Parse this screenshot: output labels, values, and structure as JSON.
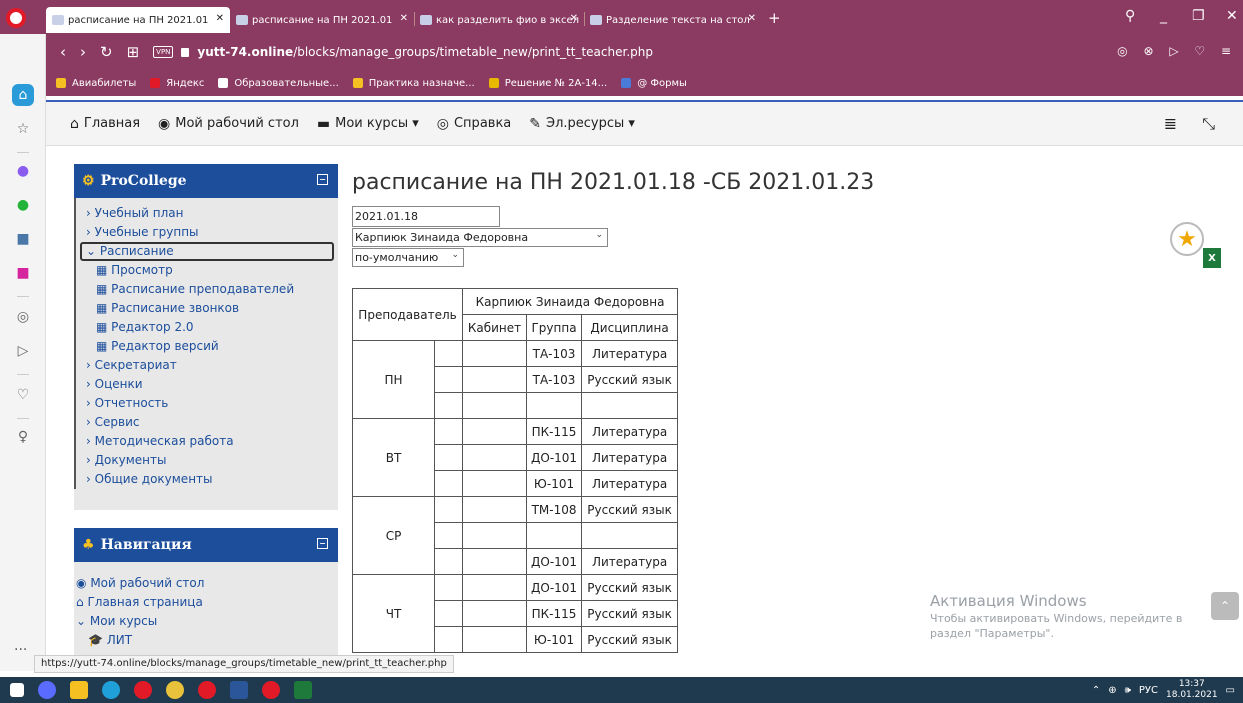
{
  "browser": {
    "tabs": [
      {
        "label": "расписание на ПН 2021.01",
        "active": true
      },
      {
        "label": "расписание на ПН 2021.01",
        "active": false
      },
      {
        "label": "как разделить фио в эксел",
        "active": false
      },
      {
        "label": "Разделение текста на стол",
        "active": false
      }
    ],
    "url_domain": "yutt-74.online",
    "url_path": "/blocks/manage_groups/timetable_new/print_tt_teacher.php",
    "vpn_label": "VPN",
    "bookmarks": [
      "Авиабилеты",
      "Яндекс",
      "Образовательные...",
      "Практика назначе...",
      "Решение № 2А-14...",
      "@ Формы"
    ],
    "status_url": "https://yutt-74.online/blocks/manage_groups/timetable_new/print_tt_teacher.php"
  },
  "navbar": {
    "items": [
      "Главная",
      "Мой рабочий стол",
      "Мои курсы ▾",
      "Справка",
      "Эл.ресурсы ▾"
    ]
  },
  "procollege": {
    "title": "ProCollege",
    "items": [
      {
        "label": "Учебный план",
        "level": 0,
        "prefix": "›"
      },
      {
        "label": "Учебные группы",
        "level": 0,
        "prefix": "›"
      },
      {
        "label": "Расписание",
        "level": 0,
        "prefix": "⌄",
        "selected": true
      },
      {
        "label": "Просмотр",
        "level": 1
      },
      {
        "label": "Расписание преподавателей",
        "level": 1
      },
      {
        "label": "Расписание звонков",
        "level": 1
      },
      {
        "label": "Редактор 2.0",
        "level": 1
      },
      {
        "label": "Редактор версий",
        "level": 1
      },
      {
        "label": "Секретариат",
        "level": 0,
        "prefix": "›"
      },
      {
        "label": "Оценки",
        "level": 0,
        "prefix": "›"
      },
      {
        "label": "Отчетность",
        "level": 0,
        "prefix": "›"
      },
      {
        "label": "Сервис",
        "level": 0,
        "prefix": "›"
      },
      {
        "label": "Методическая работа",
        "level": 0,
        "prefix": "›"
      },
      {
        "label": "Документы",
        "level": 0,
        "prefix": "›"
      },
      {
        "label": "Общие документы",
        "level": 0,
        "prefix": "›"
      }
    ]
  },
  "navigation_block": {
    "title": "Навигация",
    "items": [
      "Мой рабочий стол",
      "Главная страница",
      "Мои курсы",
      "ЛИТ"
    ]
  },
  "main": {
    "title": "расписание на ПН 2021.01.18 -СБ 2021.01.23",
    "date_value": "2021.01.18",
    "teacher_selected": "Карпиюк Зинаида Федоровна",
    "mode_selected": "по-умолчанию"
  },
  "timetable": {
    "col_teacher": "Преподаватель",
    "teacher_name": "Карпиюк Зинаида Федоровна",
    "col_room": "Кабинет",
    "col_group": "Группа",
    "col_subject": "Дисциплина",
    "days": [
      {
        "day": "ПН",
        "rows": [
          [
            "ТА-103",
            "Литература"
          ],
          [
            "ТА-103",
            "Русский язык"
          ],
          [
            "",
            ""
          ]
        ]
      },
      {
        "day": "ВТ",
        "rows": [
          [
            "ПК-115",
            "Литература"
          ],
          [
            "ДО-101",
            "Литература"
          ],
          [
            "Ю-101",
            "Литература"
          ]
        ]
      },
      {
        "day": "СР",
        "rows": [
          [
            "ТМ-108",
            "Русский язык"
          ],
          [
            "",
            ""
          ],
          [
            "ДО-101",
            "Литература"
          ]
        ]
      },
      {
        "day": "ЧТ",
        "rows": [
          [
            "ДО-101",
            "Русский язык"
          ],
          [
            "ПК-115",
            "Русский язык"
          ],
          [
            "Ю-101",
            "Русский язык"
          ]
        ]
      }
    ]
  },
  "watermark": {
    "line1": "Активация Windows",
    "line2": "Чтобы активировать Windows, перейдите в",
    "line3": "раздел \"Параметры\"."
  },
  "taskbar": {
    "lang": "РУС",
    "time": "13:37",
    "date": "18.01.2021"
  },
  "colors": {
    "browser_chrome": "#8b3a62",
    "block_header": "#1c4e9c"
  }
}
